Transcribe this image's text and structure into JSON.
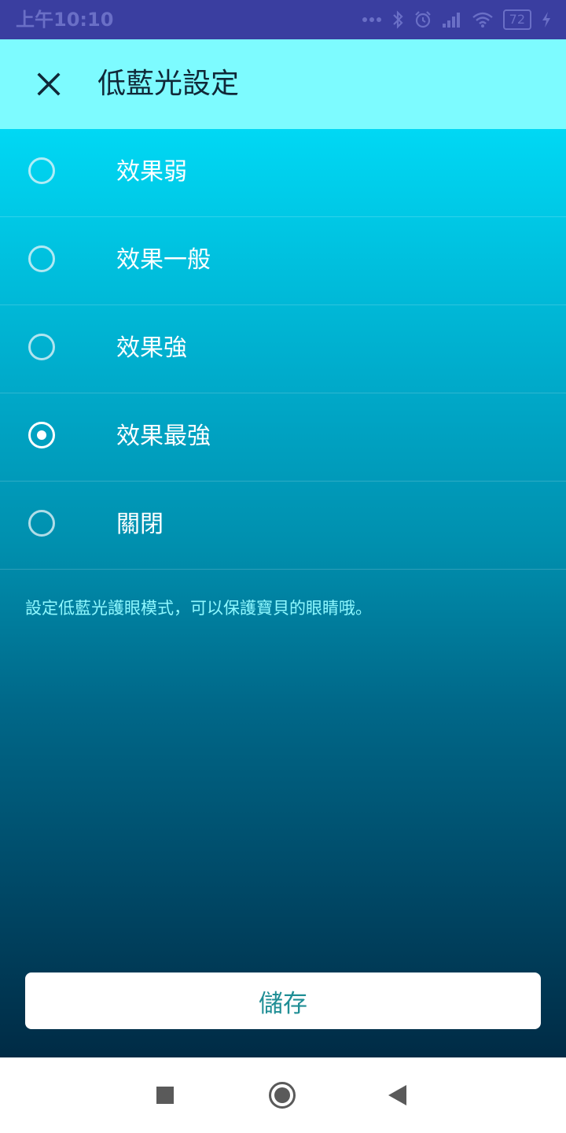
{
  "status_bar": {
    "time": "上午10:10",
    "battery_level": "72",
    "icons": [
      "more-dots-icon",
      "bluetooth-icon",
      "alarm-icon",
      "signal-icon",
      "wifi-icon",
      "battery-icon",
      "charging-icon"
    ]
  },
  "header": {
    "title": "低藍光設定",
    "close_icon": "close-icon",
    "background": "#7dfbff"
  },
  "options": [
    {
      "label": "效果弱",
      "selected": false
    },
    {
      "label": "效果一般",
      "selected": false
    },
    {
      "label": "效果強",
      "selected": false
    },
    {
      "label": "效果最強",
      "selected": true
    },
    {
      "label": "關閉",
      "selected": false
    }
  ],
  "hint": "設定低藍光護眼模式，可以保護寶貝的眼睛哦。",
  "save_button": {
    "label": "儲存"
  },
  "colors": {
    "status_bar": "#3a3ea0",
    "gradient_top": "#00d8f4",
    "gradient_bottom": "#002b45",
    "hint_text": "#8ff8ff",
    "save_text": "#1f8e95"
  },
  "nav_bar": {
    "icons": [
      "recent-apps-icon",
      "home-icon",
      "back-icon"
    ]
  }
}
